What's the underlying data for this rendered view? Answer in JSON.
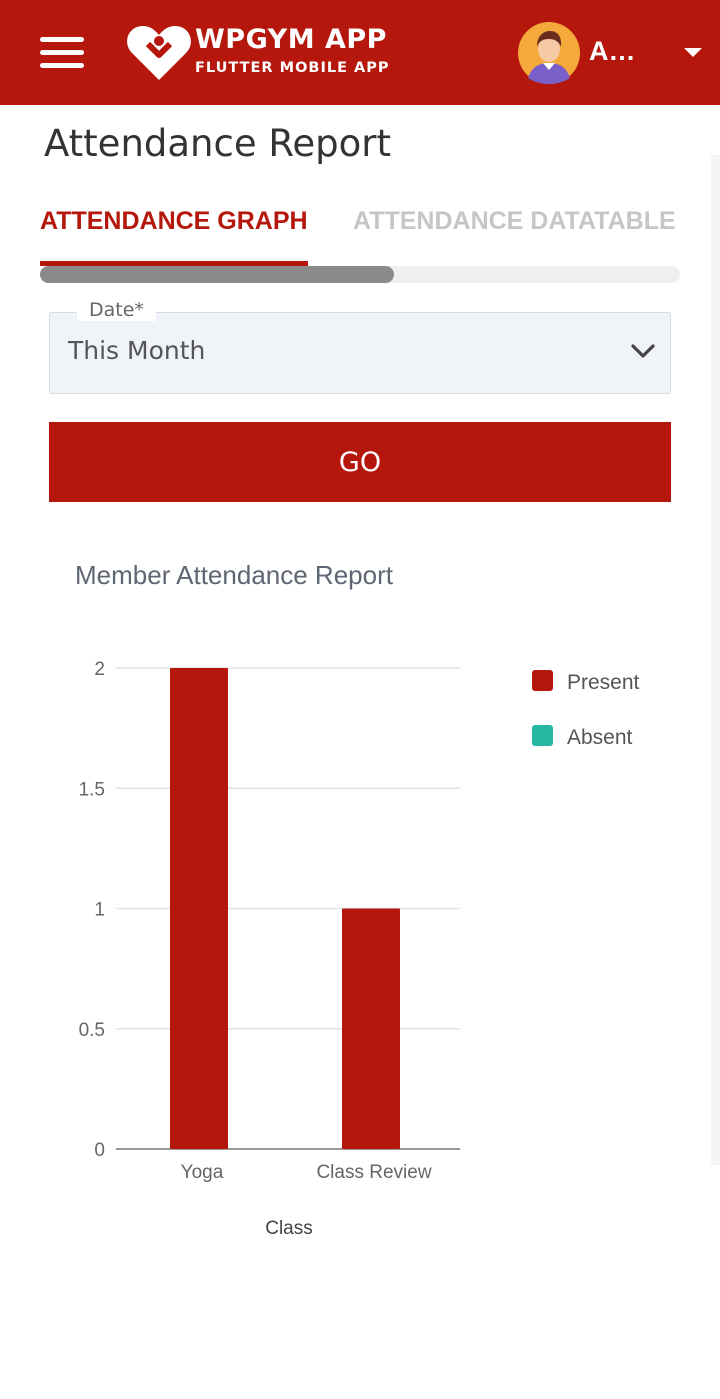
{
  "header": {
    "app_name": "WPGYM APP",
    "app_subtitle": "FLUTTER MOBILE APP",
    "user_name": "Admin",
    "brand_color": "#b5170c",
    "menu_icon": "hamburger-menu-icon",
    "logo_icon": "heart-logo-icon",
    "dropdown_icon": "caret-down-icon"
  },
  "page": {
    "title": "Attendance Report"
  },
  "tabs": [
    {
      "label": "ATTENDANCE GRAPH",
      "active": true
    },
    {
      "label": "ATTENDANCE DATATABLE",
      "active": false
    }
  ],
  "form": {
    "date_label": "Date*",
    "date_value": "This Month",
    "go_label": "GO"
  },
  "chart_title": "Member Attendance Report",
  "chart_data": {
    "type": "bar",
    "title": "Member Attendance Report",
    "categories": [
      "Yoga",
      "Class Review"
    ],
    "series": [
      {
        "name": "Present",
        "color": "#b5170c",
        "values": [
          2,
          1
        ]
      },
      {
        "name": "Absent",
        "color": "#26b6a1",
        "values": [
          0,
          0
        ]
      }
    ],
    "xlabel": "Class",
    "ylabel": "",
    "ylim": [
      0,
      2
    ],
    "yticks": [
      "0",
      "0.5",
      "1",
      "1.5",
      "2"
    ],
    "grid": true,
    "legend": "right"
  }
}
